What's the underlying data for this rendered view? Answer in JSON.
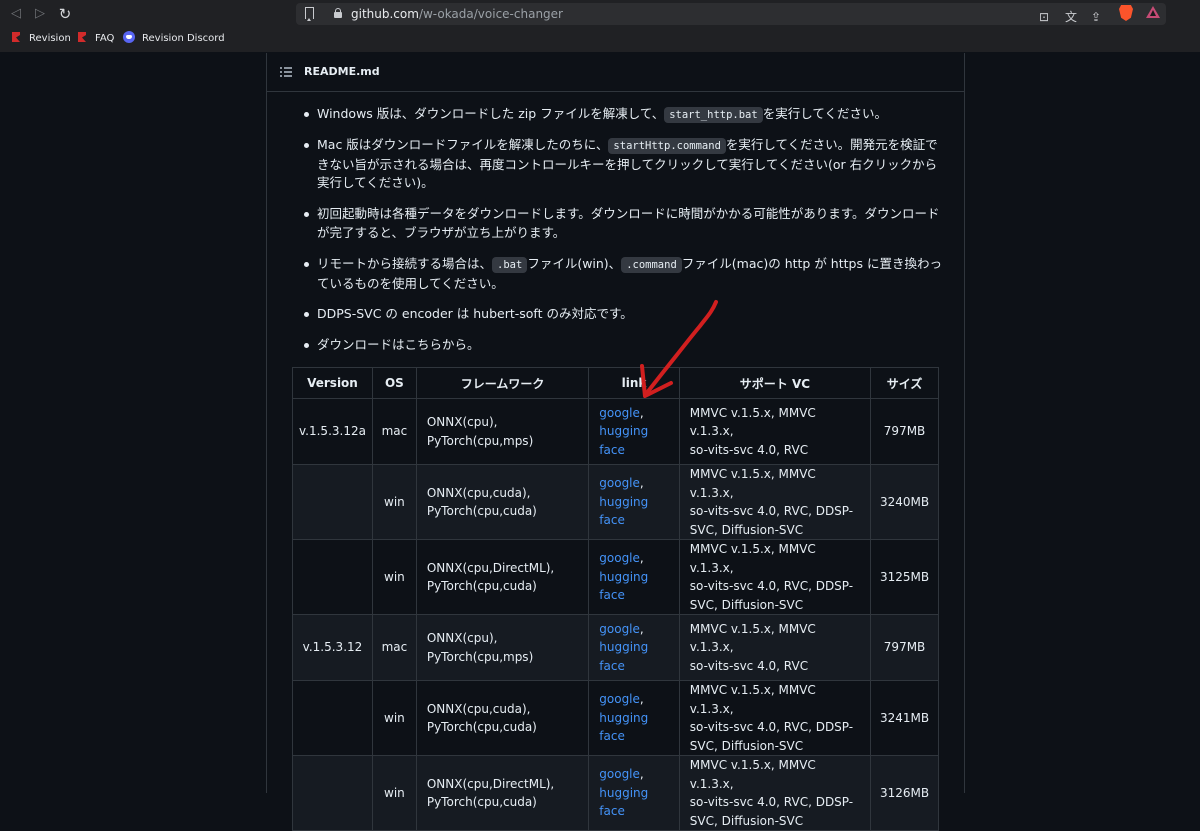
{
  "browser": {
    "url_host": "github.com",
    "url_path": "/w-okada/voice-changer",
    "bookmarks": [
      {
        "label": "Revision",
        "icon": "revision-icon"
      },
      {
        "label": "FAQ",
        "icon": "revision-icon"
      },
      {
        "label": "Revision Discord",
        "icon": "discord-icon"
      }
    ],
    "icons": [
      "back-icon",
      "forward-icon",
      "reload-icon",
      "bookmark-icon",
      "lock-icon",
      "install-icon",
      "translate-icon",
      "share-icon",
      "brave-shields-icon",
      "brave-rewards-icon"
    ]
  },
  "readme": {
    "title": "README.md",
    "bullets": [
      {
        "pre": "Windows 版は、ダウンロードした zip ファイルを解凍して、",
        "code": "start_http.bat",
        "post": "を実行してください。"
      },
      {
        "pre": "Mac 版はダウンロードファイルを解凍したのちに、",
        "code": "startHttp.command",
        "post": "を実行してください。開発元を検証できない旨が示される場合は、再度コントロールキーを押してクリックして実行してください(or 右クリックから実行してください)。"
      },
      {
        "text": "初回起動時は各種データをダウンロードします。ダウンロードに時間がかかる可能性があります。ダウンロードが完了すると、ブラウザが立ち上がります。"
      },
      {
        "pre": "リモートから接続する場合は、",
        "code": ".bat",
        "mid": "ファイル(win)、",
        "code2": ".command",
        "post": "ファイル(mac)の http が https に置き換わっているものを使用してください。"
      },
      {
        "text": "DDPS-SVC の encoder は hubert-soft のみ対応です。"
      },
      {
        "text": "ダウンロードはこちらから。"
      }
    ],
    "table": {
      "headers": [
        "Version",
        "OS",
        "フレームワーク",
        "link",
        "サポート VC",
        "サイズ"
      ],
      "rows": [
        {
          "version": "v.1.5.3.12a",
          "os": "mac",
          "framework": [
            "ONNX(cpu),",
            "PyTorch(cpu,mps)"
          ],
          "link1": "google",
          "link2": "hugging",
          "link3": "face",
          "vc": [
            "MMVC v.1.5.x, MMVC v.1.3.x,",
            "so-vits-svc 4.0, RVC"
          ],
          "size": "797MB"
        },
        {
          "version": "",
          "os": "win",
          "framework": [
            "ONNX(cpu,cuda),",
            "PyTorch(cpu,cuda)"
          ],
          "link1": "google",
          "link2": "hugging",
          "link3": "face",
          "vc": [
            "MMVC v.1.5.x, MMVC v.1.3.x,",
            "so-vits-svc 4.0, RVC, DDSP-",
            "SVC, Diffusion-SVC"
          ],
          "size": "3240MB"
        },
        {
          "version": "",
          "os": "win",
          "framework": [
            "ONNX(cpu,DirectML),",
            "PyTorch(cpu,cuda)"
          ],
          "link1": "google",
          "link2": "hugging",
          "link3": "face",
          "vc": [
            "MMVC v.1.5.x, MMVC v.1.3.x,",
            "so-vits-svc 4.0, RVC, DDSP-",
            "SVC, Diffusion-SVC"
          ],
          "size": "3125MB"
        },
        {
          "version": "v.1.5.3.12",
          "os": "mac",
          "framework": [
            "ONNX(cpu),",
            "PyTorch(cpu,mps)"
          ],
          "link1": "google",
          "link2": "hugging",
          "link3": "face",
          "vc": [
            "MMVC v.1.5.x, MMVC v.1.3.x,",
            "so-vits-svc 4.0, RVC"
          ],
          "size": "797MB"
        },
        {
          "version": "",
          "os": "win",
          "framework": [
            "ONNX(cpu,cuda),",
            "PyTorch(cpu,cuda)"
          ],
          "link1": "google",
          "link2": "hugging",
          "link3": "face",
          "vc": [
            "MMVC v.1.5.x, MMVC v.1.3.x,",
            "so-vits-svc 4.0, RVC, DDSP-",
            "SVC, Diffusion-SVC"
          ],
          "size": "3241MB"
        },
        {
          "version": "",
          "os": "win",
          "framework": [
            "ONNX(cpu,DirectML),",
            "PyTorch(cpu,cuda)"
          ],
          "link1": "google",
          "link2": "hugging",
          "link3": "face",
          "vc": [
            "MMVC v.1.5.x, MMVC v.1.3.x,",
            "so-vits-svc 4.0, RVC, DDSP-",
            "SVC, Diffusion-SVC"
          ],
          "size": "3126MB"
        }
      ]
    }
  },
  "annotation": {
    "color": "#d11f1f"
  }
}
